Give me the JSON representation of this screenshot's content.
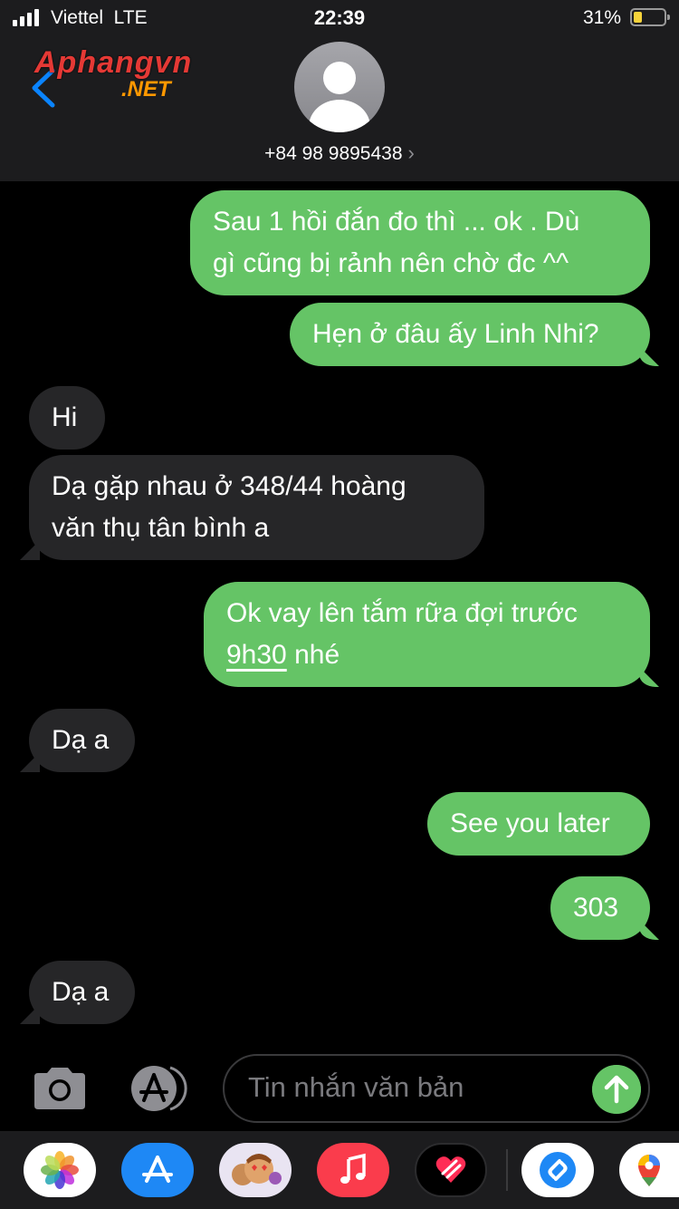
{
  "status_bar": {
    "carrier": "Viettel",
    "network": "LTE",
    "time": "22:39",
    "battery_percent": "31%",
    "battery_level": 0.31
  },
  "header": {
    "logo_line1": "Aphangvn",
    "logo_line2": ".NET",
    "phone_number": "+84 98 9895438",
    "chevron": "›"
  },
  "messages": [
    {
      "direction": "outgoing",
      "lines": [
        "Sau 1 hồi đắn đo thì ... ok . Dù",
        "gì cũng bị rảnh nên chờ đc ^^"
      ]
    },
    {
      "direction": "outgoing",
      "lines": [
        "Hẹn ở đâu ấy Linh Nhi?"
      ]
    },
    {
      "direction": "incoming",
      "lines": [
        "Hi"
      ]
    },
    {
      "direction": "incoming",
      "lines": [
        "Dạ gặp nhau ở 348/44 hoàng",
        "văn thụ tân bình a"
      ]
    },
    {
      "direction": "outgoing",
      "lines": [
        "Ok  vay lên tắm rữa đợi trước",
        "9h30",
        " nhé"
      ]
    },
    {
      "direction": "incoming",
      "lines": [
        "Dạ a"
      ]
    },
    {
      "direction": "outgoing",
      "lines": [
        "See you later"
      ]
    },
    {
      "direction": "outgoing",
      "lines": [
        "303"
      ]
    },
    {
      "direction": "incoming",
      "lines": [
        "Dạ a"
      ]
    }
  ],
  "input_bar": {
    "placeholder": "Tin nhắn văn bản",
    "camera_icon": "camera-icon",
    "appstore_icon": "app-store-icon",
    "send_icon": "arrow-up-icon"
  },
  "dock": {
    "apps": [
      "photos-icon",
      "app-store-icon",
      "memoji-icon",
      "music-icon",
      "digital-touch-icon",
      "shazam-icon",
      "maps-icon"
    ]
  },
  "colors": {
    "outgoing_bubble": "#65c466",
    "incoming_bubble": "#262628",
    "header_bg": "#1c1c1e"
  }
}
